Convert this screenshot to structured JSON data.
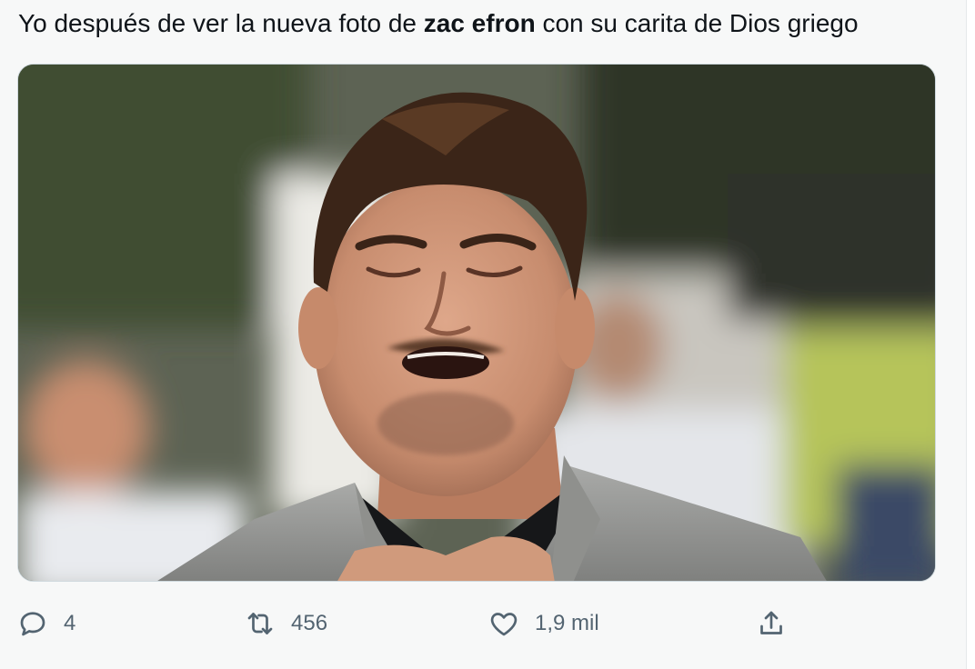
{
  "tweet": {
    "text_before": "Yo después de ver la nueva foto de ",
    "text_bold": "zac efron",
    "text_after": " con su carita de Dios griego"
  },
  "actions": {
    "reply": {
      "icon": "reply-icon",
      "count": "4"
    },
    "retweet": {
      "icon": "retweet-icon",
      "count": "456"
    },
    "like": {
      "icon": "heart-icon",
      "count": "1,9 mil"
    },
    "share": {
      "icon": "share-icon"
    }
  },
  "colors": {
    "background": "#f7f8f8",
    "text": "#0f1419",
    "secondary": "#536471",
    "border": "#cfd9de"
  }
}
